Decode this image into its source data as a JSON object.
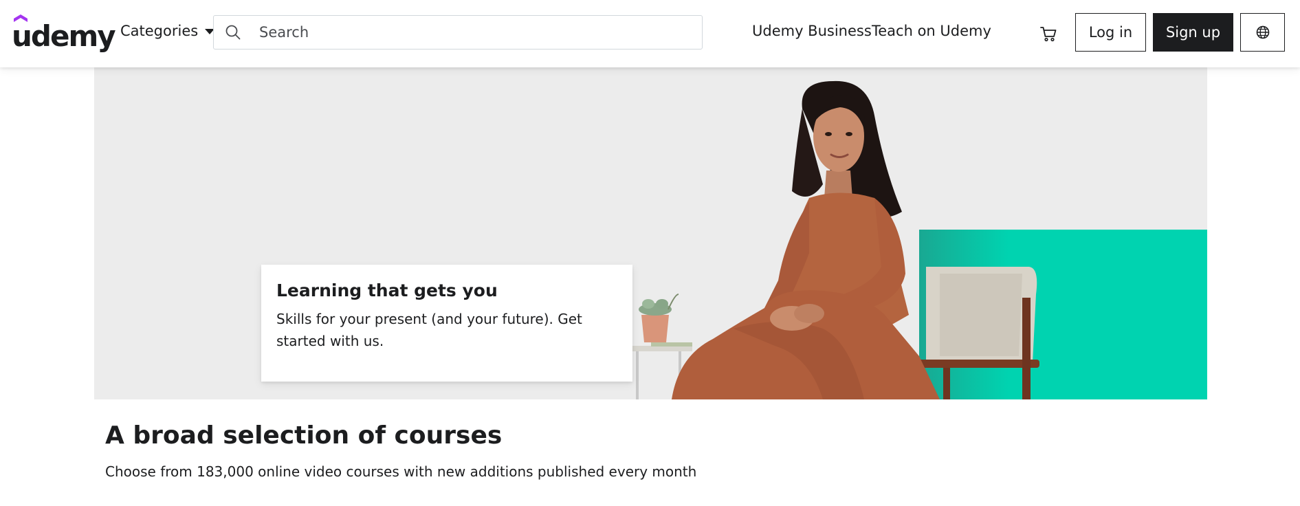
{
  "header": {
    "logo_text": "udemy",
    "categories_label": "Categories",
    "search": {
      "placeholder": "Search",
      "value": ""
    },
    "nav_links": {
      "business": "Udemy Business",
      "teach": "Teach on Udemy"
    },
    "login_label": "Log in",
    "signup_label": "Sign up",
    "icons": {
      "search": "search-icon",
      "cart": "cart-icon",
      "language": "globe-icon",
      "categories_caret": "caret-down-icon"
    }
  },
  "hero": {
    "title": "Learning that gets you",
    "subtitle": "Skills for your present (and your future). Get started with us."
  },
  "section": {
    "title": "A broad selection of courses",
    "subtitle": "Choose from 183,000 online video courses with new additions published every month"
  },
  "colors": {
    "brand_purple": "#a435f0",
    "text_dark": "#1c1d1f",
    "hero_bg": "#ececec",
    "hero_teal": "#00d3b0",
    "border": "#d1d7dc"
  }
}
